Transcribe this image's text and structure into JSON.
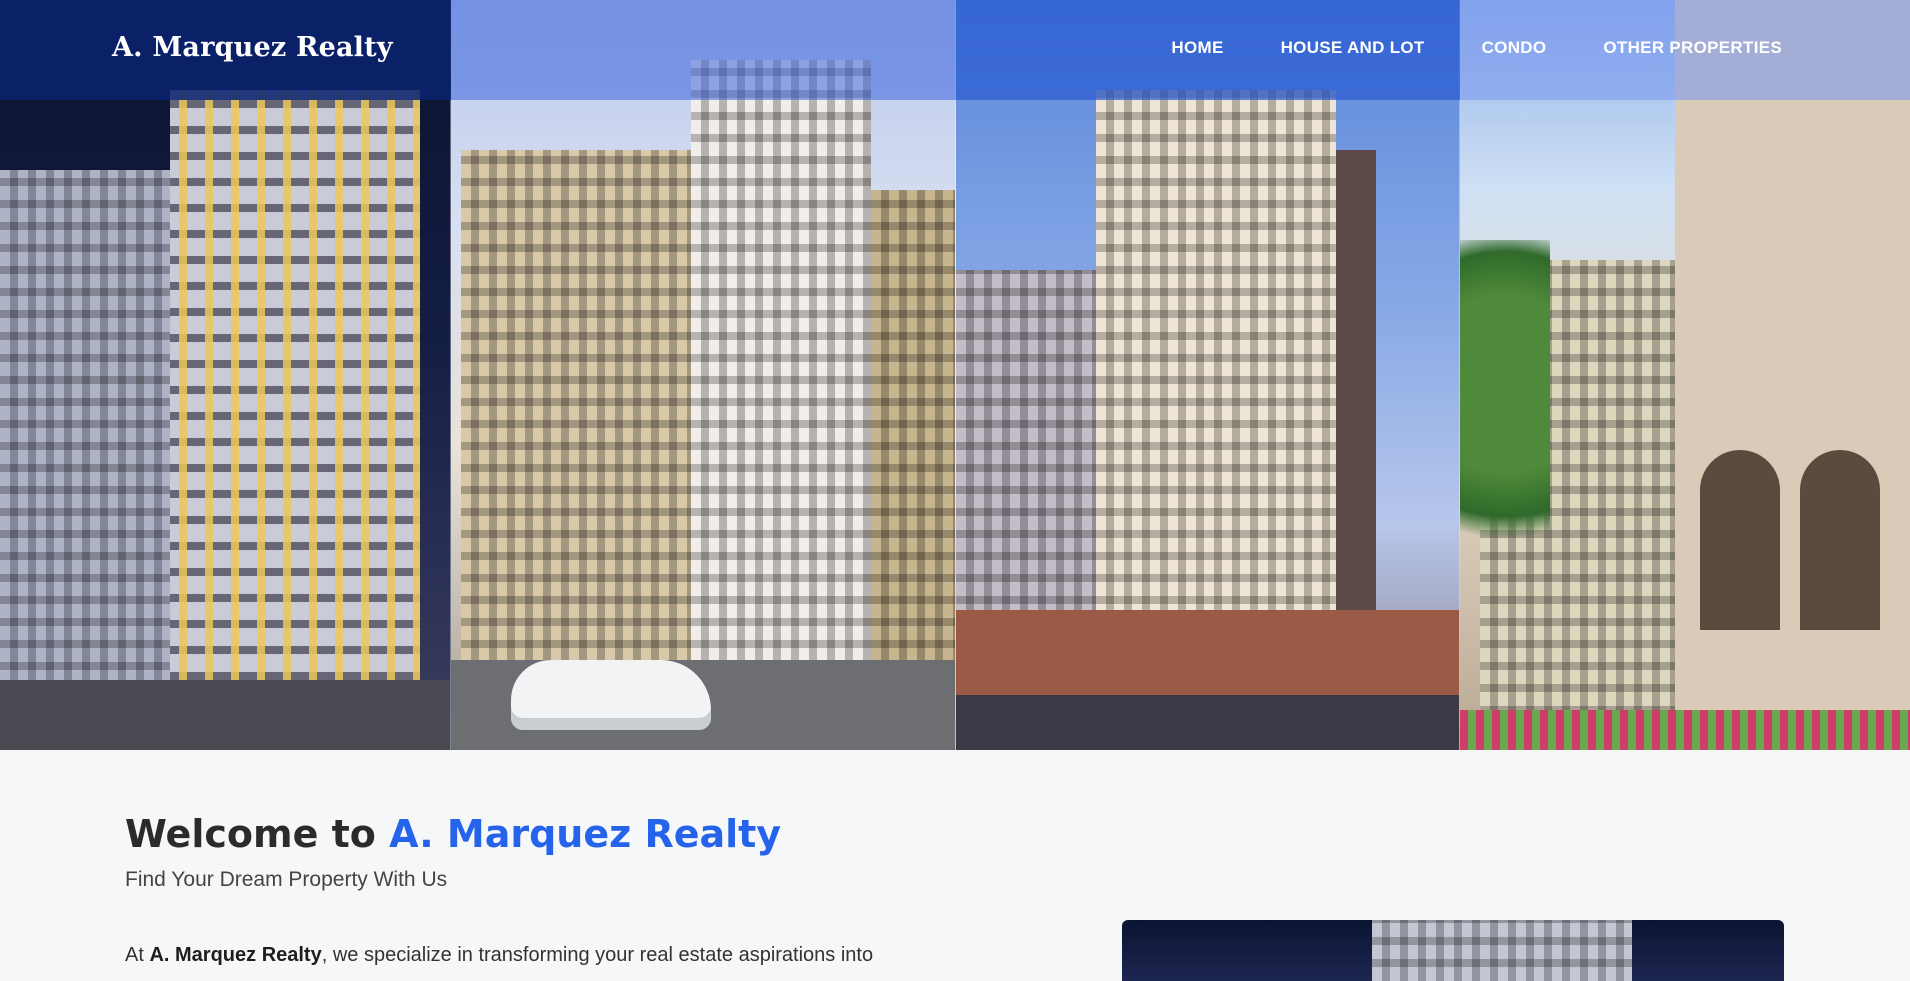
{
  "header": {
    "logo_text": "A. Marquez Realty",
    "nav": [
      {
        "label": "HOME"
      },
      {
        "label": "HOUSE AND LOT"
      },
      {
        "label": "CONDO"
      },
      {
        "label": "OTHER PROPERTIES"
      }
    ]
  },
  "hero": {
    "panels": [
      {
        "scene": "condo-tower-night"
      },
      {
        "scene": "condo-tower-day"
      },
      {
        "scene": "twin-towers-street"
      },
      {
        "scene": "commercial-street"
      }
    ]
  },
  "main": {
    "welcome_prefix": "Welcome to ",
    "welcome_brand": "A. Marquez Realty",
    "tagline": "Find Your Dream Property With Us",
    "intro_prefix": "At ",
    "intro_brand": "A. Marquez Realty",
    "intro_rest": ", we specialize in transforming your real estate aspirations into"
  },
  "colors": {
    "brand_blue": "#2563eb",
    "nav_dark": "#0a236e",
    "text_dark": "#2b2b2b"
  }
}
